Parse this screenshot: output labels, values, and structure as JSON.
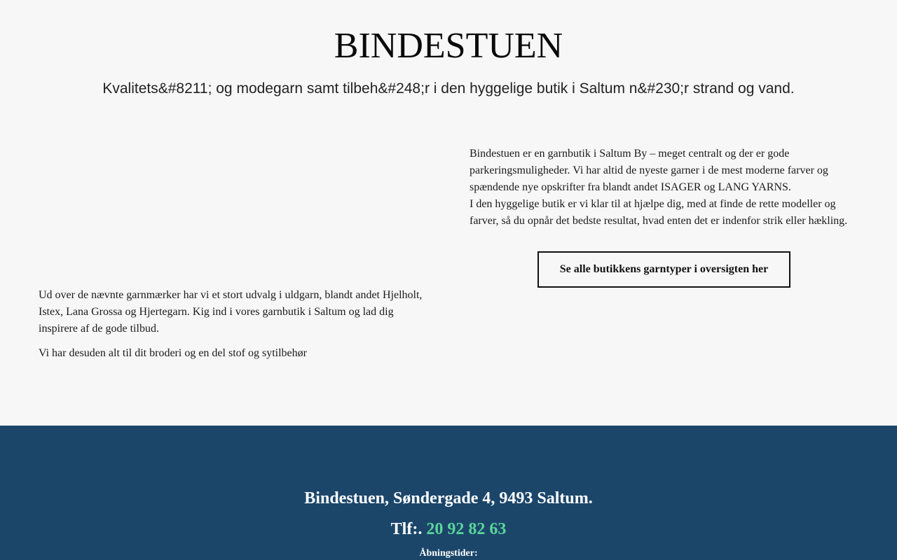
{
  "header": {
    "title": "BINDESTUEN",
    "tagline": "Kvalitets&#8211; og modegarn samt tilbeh&#248;r i den hyggelige butik i Saltum n&#230;r strand og vand."
  },
  "right_column": {
    "paragraph_1": "Bindestuen er en garnbutik i Saltum By – meget centralt og der er gode parkeringsmuligheder. Vi har altid de nyeste garner i de mest moderne farver og spændende nye opskrifter fra blandt andet ISAGER og LANG YARNS.",
    "paragraph_2": "I den hyggelige butik er vi klar til at hjælpe dig, med at finde de rette modeller og farver, så du opnår det bedste resultat, hvad enten det er indenfor strik eller hækling.",
    "button_label": "Se alle butikkens garntyper i oversigten her"
  },
  "left_column": {
    "paragraph_1": "Ud over de nævnte garnmærker har vi et stort udvalg i uldgarn, blandt andet Hjelholt, Istex, Lana Grossa og Hjertegarn. Kig ind i vores garnbutik i Saltum og lad dig inspirere af de gode tilbud.",
    "paragraph_2": "Vi har desuden alt til dit broderi og en del stof og sytilbehør"
  },
  "footer": {
    "address": "Bindestuen, Søndergade 4, 9493 Saltum.",
    "phone_prefix": "Tlf:.",
    "phone_number": "20 92 82 63",
    "hours_label": "Åbningstider:",
    "background_color": "#1b466a",
    "link_color": "#5bd49b"
  }
}
